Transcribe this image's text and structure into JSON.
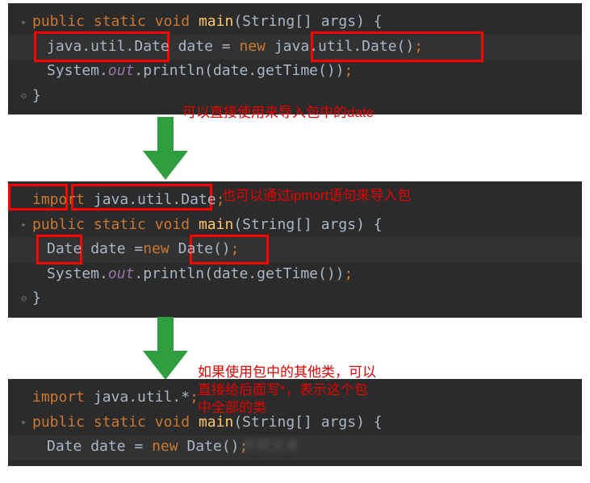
{
  "block1": {
    "l1": {
      "kw1": "public",
      "kw2": "static",
      "kw3": "void",
      "method": "main",
      "type": "String",
      "arr": "[]",
      "param": "args",
      "brace": "{"
    },
    "l2": {
      "pkg": "java.util.Date",
      "var": "date",
      "eq": "=",
      "kw": "new",
      "ctor": "java.util.Date",
      "call": "()",
      "semi": ";"
    },
    "l3": {
      "cls": "System",
      "dot1": ".",
      "field": "out",
      "dot2": ".",
      "method": "println",
      "open": "(",
      "arg1": "date",
      "dot3": ".",
      "call": "getTime",
      "close": "())",
      "semi": ";"
    },
    "l4": {
      "brace": "}"
    }
  },
  "anno1": "可以直接使用来导入包中的date",
  "block2": {
    "l0": {
      "kw": "import",
      "pkg": "java.util.Date",
      "semi": ";"
    },
    "l1": {
      "kw1": "public",
      "kw2": "static",
      "kw3": "void",
      "method": "main",
      "type": "String",
      "arr": "[]",
      "param": "args",
      "brace": "{"
    },
    "l2": {
      "type": "Date",
      "var": "date",
      "eq": "=",
      "kw": "new",
      "ctor": "Date",
      "call": "()",
      "semi": ";"
    },
    "l3": {
      "cls": "System",
      "dot1": ".",
      "field": "out",
      "dot2": ".",
      "method": "println",
      "open": "(",
      "arg1": "date",
      "dot3": ".",
      "call": "getTime",
      "close": "())",
      "semi": ";"
    },
    "l4": {
      "brace": "}"
    }
  },
  "anno2": "也可以通过ipmort语句来导入包",
  "block3": {
    "l0": {
      "kw": "import",
      "pkg": "java.util.*",
      "semi": ";"
    },
    "l1": {
      "kw1": "public",
      "kw2": "static",
      "kw3": "void",
      "method": "main",
      "type": "String",
      "arr": "[]",
      "param": "args",
      "brace": "{"
    },
    "l2": {
      "type": "Date",
      "var": "date",
      "eq": "=",
      "kw": "new",
      "ctor": "Date",
      "call": "()",
      "semi": ";"
    }
  },
  "anno3a": "如果使用包中的其他类，可以",
  "anno3b": "直接给后面写*，表示这个包",
  "anno3c": "中全部的类"
}
